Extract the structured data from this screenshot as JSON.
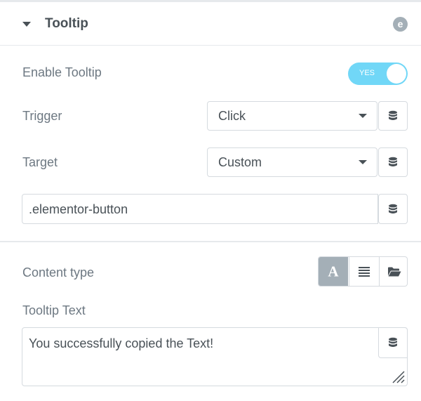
{
  "section": {
    "title": "Tooltip",
    "caret_icon": "caret-down-icon",
    "brand_icon": "elementor-e-icon",
    "brand_glyph": "e"
  },
  "enable_tooltip": {
    "label": "Enable Tooltip",
    "toggle_text": "YES",
    "on": true,
    "color": "#71d7f7"
  },
  "trigger": {
    "label": "Trigger",
    "value": "Click",
    "dynamic_icon": "database-icon"
  },
  "target": {
    "label": "Target",
    "value": "Custom",
    "dynamic_icon": "database-icon"
  },
  "custom_selector": {
    "value": ".elementor-button",
    "dynamic_icon": "database-icon"
  },
  "content_type": {
    "label": "Content type",
    "options": [
      {
        "name": "text",
        "icon": "text-a-icon",
        "glyph": "A",
        "active": true
      },
      {
        "name": "template",
        "icon": "align-justify-icon",
        "active": false
      },
      {
        "name": "saved",
        "icon": "folder-open-icon",
        "active": false
      }
    ]
  },
  "tooltip_text": {
    "label": "Tooltip Text",
    "value": "You successfully copied the Text!",
    "dynamic_icon": "database-icon",
    "resize_icon": "resize-grip-icon"
  },
  "colors": {
    "heading": "#495157",
    "label": "#6d7882",
    "border": "#d5dadf",
    "active_choice": "#a4afb7"
  }
}
